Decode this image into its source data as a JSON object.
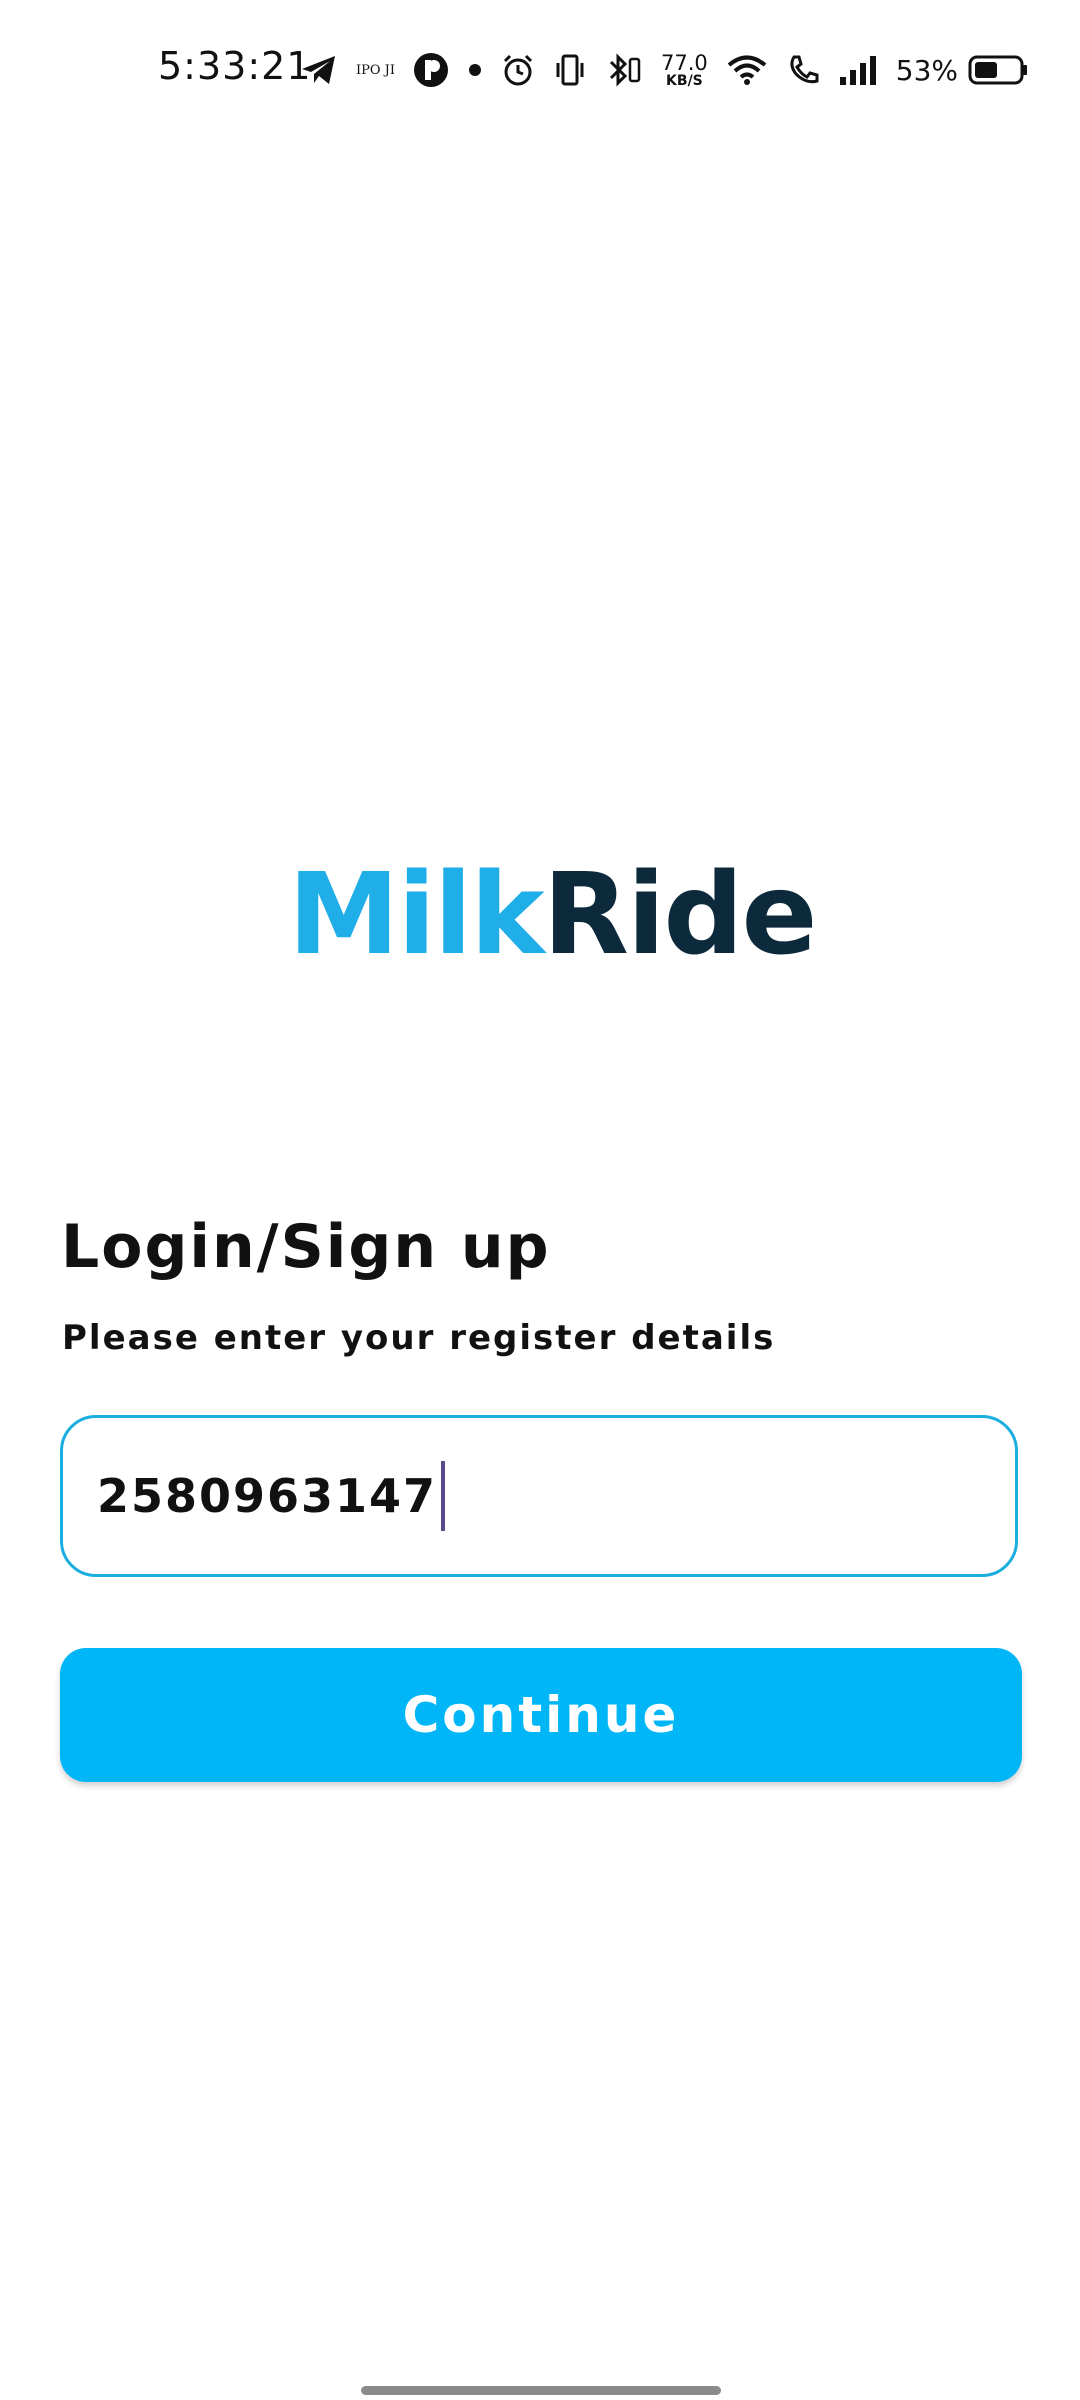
{
  "status_bar": {
    "time": "5:33:21",
    "carrier_text": "IPO JI",
    "network_speed_value": "77.0",
    "network_speed_unit": "KB/S",
    "battery_percent": "53%",
    "battery_level": 0.53,
    "icons": [
      "telegram-icon",
      "ipo-icon",
      "app-icon",
      "dot-icon",
      "alarm-icon",
      "vibrate-icon",
      "bluetooth-icon",
      "wifi-icon",
      "wifi-calling-icon",
      "signal-icon",
      "battery-icon"
    ]
  },
  "logo": {
    "part1": "Milk",
    "part2": "Ride",
    "colors": {
      "milk": "#20aee8",
      "ride": "#0d2a3d"
    }
  },
  "login": {
    "title": "Login/Sign up",
    "subtitle": "Please enter your register details",
    "phone_value": "2580963147",
    "continue_label": "Continue"
  },
  "colors": {
    "accent": "#00b6f6",
    "field_border": "#1aaee0"
  }
}
